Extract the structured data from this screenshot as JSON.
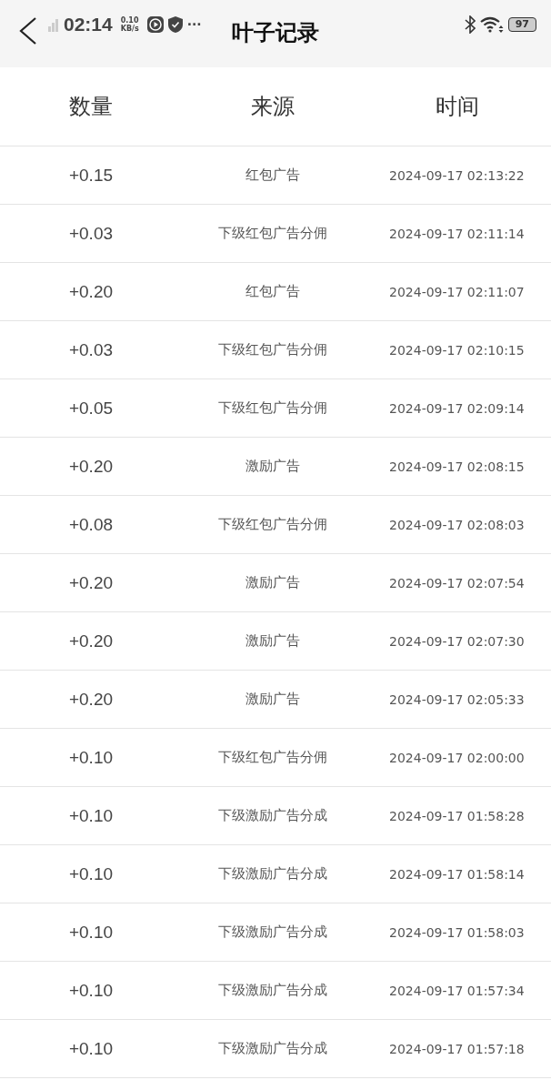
{
  "status_bar": {
    "time": "02:14",
    "speed_value": "0.10",
    "speed_unit": "KB/s",
    "more": "···",
    "battery": "97"
  },
  "header": {
    "title": "叶子记录"
  },
  "table": {
    "columns": [
      "数量",
      "来源",
      "时间"
    ],
    "rows": [
      {
        "amount": "+0.15",
        "source": "红包广告",
        "time": "2024-09-17 02:13:22"
      },
      {
        "amount": "+0.03",
        "source": "下级红包广告分佣",
        "time": "2024-09-17 02:11:14"
      },
      {
        "amount": "+0.20",
        "source": "红包广告",
        "time": "2024-09-17 02:11:07"
      },
      {
        "amount": "+0.03",
        "source": "下级红包广告分佣",
        "time": "2024-09-17 02:10:15"
      },
      {
        "amount": "+0.05",
        "source": "下级红包广告分佣",
        "time": "2024-09-17 02:09:14"
      },
      {
        "amount": "+0.20",
        "source": "激励广告",
        "time": "2024-09-17 02:08:15"
      },
      {
        "amount": "+0.08",
        "source": "下级红包广告分佣",
        "time": "2024-09-17 02:08:03"
      },
      {
        "amount": "+0.20",
        "source": "激励广告",
        "time": "2024-09-17 02:07:54"
      },
      {
        "amount": "+0.20",
        "source": "激励广告",
        "time": "2024-09-17 02:07:30"
      },
      {
        "amount": "+0.20",
        "source": "激励广告",
        "time": "2024-09-17 02:05:33"
      },
      {
        "amount": "+0.10",
        "source": "下级红包广告分佣",
        "time": "2024-09-17 02:00:00"
      },
      {
        "amount": "+0.10",
        "source": "下级激励广告分成",
        "time": "2024-09-17 01:58:28"
      },
      {
        "amount": "+0.10",
        "source": "下级激励广告分成",
        "time": "2024-09-17 01:58:14"
      },
      {
        "amount": "+0.10",
        "source": "下级激励广告分成",
        "time": "2024-09-17 01:58:03"
      },
      {
        "amount": "+0.10",
        "source": "下级激励广告分成",
        "time": "2024-09-17 01:57:34"
      },
      {
        "amount": "+0.10",
        "source": "下级激励广告分成",
        "time": "2024-09-17 01:57:18"
      }
    ]
  }
}
